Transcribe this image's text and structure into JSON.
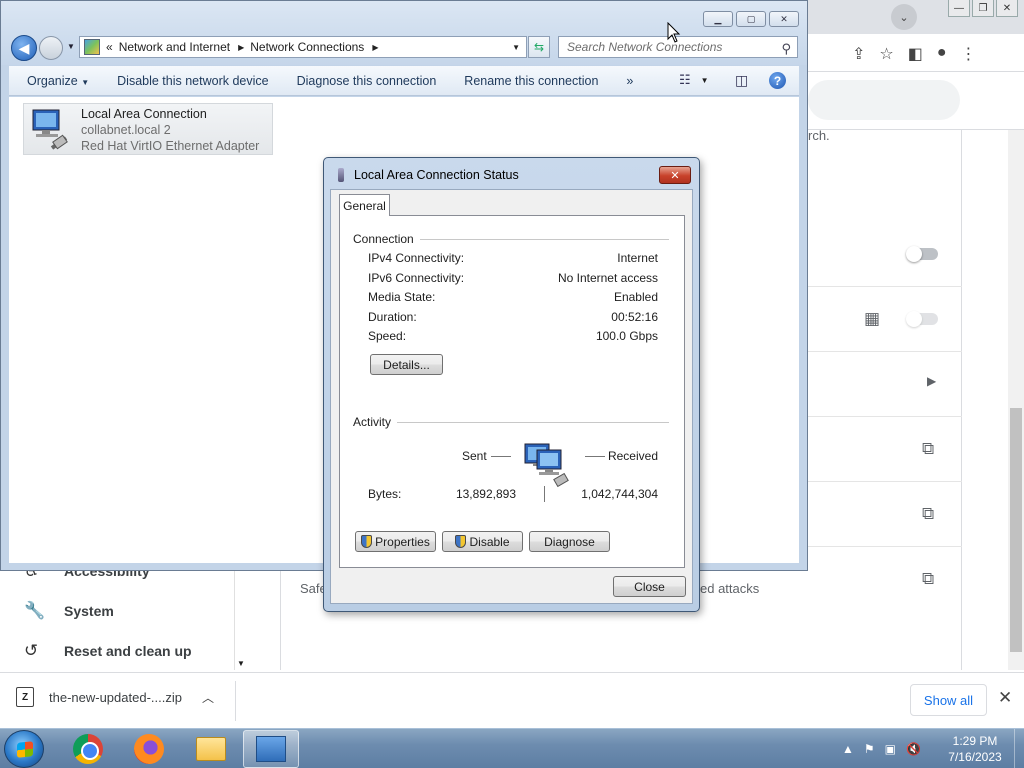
{
  "chrome": {
    "sidebar": [
      {
        "label": "Accessibility",
        "icon": "accessibility-icon"
      },
      {
        "label": "System",
        "icon": "wrench-icon"
      },
      {
        "label": "Reset and clean up",
        "icon": "reset-icon"
      }
    ],
    "content_snippets": {
      "search_hint_tail": "rch.",
      "safe_prefix": "Safe",
      "attacks_tail": "ed attacks"
    },
    "download": {
      "filename": "the-new-updated-....zip",
      "show_all": "Show all"
    }
  },
  "explorer": {
    "breadcrumb": [
      "Network and Internet",
      "Network Connections"
    ],
    "search_placeholder": "Search Network Connections",
    "commands": [
      "Organize",
      "Disable this network device",
      "Diagnose this connection",
      "Rename this connection"
    ],
    "more": "»",
    "connection": {
      "name": "Local Area Connection",
      "network": "collabnet.local  2",
      "adapter": "Red Hat VirtIO Ethernet Adapter"
    }
  },
  "status_dialog": {
    "title": "Local Area Connection Status",
    "tab": "General",
    "connection_group": "Connection",
    "fields": [
      {
        "label": "IPv4 Connectivity:",
        "value": "Internet"
      },
      {
        "label": "IPv6 Connectivity:",
        "value": "No Internet access"
      },
      {
        "label": "Media State:",
        "value": "Enabled"
      },
      {
        "label": "Duration:",
        "value": "00:52:16"
      },
      {
        "label": "Speed:",
        "value": "100.0 Gbps"
      }
    ],
    "details_button": "Details...",
    "activity_group": "Activity",
    "sent_label": "Sent",
    "received_label": "Received",
    "bytes_label": "Bytes:",
    "bytes_sent": "13,892,893",
    "bytes_received": "1,042,744,304",
    "buttons": {
      "properties": "Properties",
      "disable": "Disable",
      "diagnose": "Diagnose",
      "close": "Close"
    }
  },
  "taskbar": {
    "time": "1:29 PM",
    "date": "7/16/2023"
  }
}
